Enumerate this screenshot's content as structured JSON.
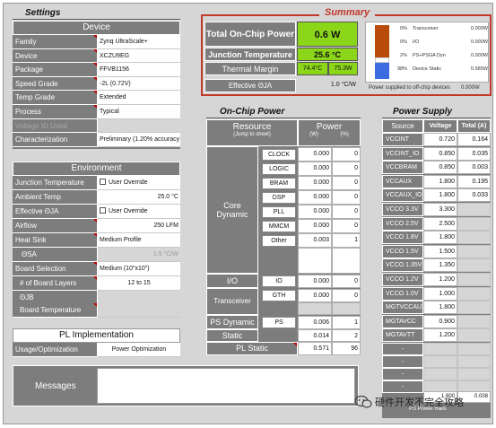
{
  "colors": {
    "accent_red": "#c0392b",
    "power_green": "#8cd61a",
    "orange": "#b84a0a",
    "blue": "#3d6be0"
  },
  "settings": {
    "title": "Settings",
    "device": {
      "header": "Device",
      "rows": [
        {
          "label": "Family",
          "value": "Zynq UltraScale+"
        },
        {
          "label": "Device",
          "value": "XCZU9EG"
        },
        {
          "label": "Package",
          "value": "FFVB1156"
        },
        {
          "label": "Speed Grade",
          "value": "-2L (0.72V)"
        },
        {
          "label": "Temp Grade",
          "value": "Extended"
        },
        {
          "label": "Process",
          "value": "Typical"
        },
        {
          "label": "Voltage ID Used",
          "value": ""
        },
        {
          "label": "Characterization",
          "value": "Preliminary (1.20% accuracy"
        }
      ]
    },
    "environment": {
      "header": "Environment",
      "junction_temp_label": "Junction Temperature",
      "junction_temp_value": "User Override",
      "ambient_label": "Ambient Temp",
      "ambient_value": "25.0 °C",
      "theta_label": "Effective ΘJA",
      "theta_value": "User Override",
      "airflow_label": "Airflow",
      "airflow_value": "250 LFM",
      "heatsink_label": "Heat Sink",
      "heatsink_value": "Medium Profile",
      "sa_label": "ΘSA",
      "sa_value": "1.5 °C/W",
      "board_sel_label": "Board Selection",
      "board_sel_value": "Medium (10\"x10\")",
      "layers_label": "# of Board Layers",
      "layers_value": "12 to 15",
      "jb_label": "ΘJB",
      "jb_value": "",
      "board_temp_label": "Board Temperature",
      "board_temp_value": ""
    },
    "pl_impl": {
      "header": "PL Implementation",
      "usage_label": "Usage/Optimization",
      "usage_value": "Power Optimization"
    }
  },
  "messages": {
    "label": "Messages",
    "text": ""
  },
  "summary": {
    "title": "Summary",
    "total_label": "Total On-Chip Power",
    "total_value": "0.6 W",
    "junction_label": "Junction Temperature",
    "junction_value": "25.6 °C",
    "margin_label": "Thermal Margin",
    "margin_c": "74.4°C",
    "margin_w": "75.3W",
    "theta_label": "Effective ΘJA",
    "theta_value": "1.0 °C/W",
    "breakdown": [
      {
        "pct": "0%",
        "name": "Transceiver",
        "value": "0.000W"
      },
      {
        "pct": "0%",
        "name": "I/O",
        "value": "0.000W"
      },
      {
        "pct": "2%",
        "name": "PS+PSGA Dyn",
        "value": "0.000W"
      },
      {
        "pct": "98%",
        "name": "Device Static",
        "value": "0.585W"
      }
    ],
    "offchip_label": "Power supplied to off-chip devices",
    "offchip_value": "0.000W"
  },
  "onchip": {
    "title": "On-Chip Power",
    "resource_header": "Resource",
    "jump_label": "(Jump to sheet)",
    "power_header": "Power",
    "w_header": "(W)",
    "pct_header": "(%)",
    "core_label": "Core Dynamic",
    "core_rows": [
      {
        "name": "CLOCK",
        "w": "0.000",
        "pct": "0"
      },
      {
        "name": "LOGIC",
        "w": "0.000",
        "pct": "0"
      },
      {
        "name": "BRAM",
        "w": "0.000",
        "pct": "0"
      },
      {
        "name": "DSP",
        "w": "0.000",
        "pct": "0"
      },
      {
        "name": "PLL",
        "w": "0.000",
        "pct": "0"
      },
      {
        "name": "MMCM",
        "w": "0.000",
        "pct": "0"
      },
      {
        "name": "Other",
        "w": "0.003",
        "pct": "1"
      }
    ],
    "io_label": "I/O",
    "io_row": {
      "name": "IO",
      "w": "0.000",
      "pct": "0"
    },
    "trans_label": "Transceiver",
    "trans_row": {
      "name": "GTH",
      "w": "0.000",
      "pct": "0"
    },
    "ps_label": "PS Dynamic",
    "ps_row": {
      "name": "PS",
      "w": "0.006",
      "pct": "1"
    },
    "static_label": "Static",
    "static_row": {
      "w": "0.014",
      "pct": "2"
    },
    "pl_static_label": "PL Static",
    "pl_static_row": {
      "w": "0.571",
      "pct": "96"
    }
  },
  "power_supply": {
    "title": "Power Supply",
    "headers": [
      "Source",
      "Voltage",
      "Total (A)"
    ],
    "rows": [
      {
        "source": "VCCINT",
        "voltage": "0.720",
        "total": "0.164"
      },
      {
        "source": "VCCINT_IO",
        "voltage": "0.850",
        "total": "0.035"
      },
      {
        "source": "VCCBRAM",
        "voltage": "0.850",
        "total": "0.003"
      },
      {
        "source": "VCCAUX",
        "voltage": "1.800",
        "total": "0.195"
      },
      {
        "source": "VCCAUX_IO",
        "voltage": "1.800",
        "total": "0.033"
      },
      {
        "source": "VCCO 3.3V",
        "voltage": "3.300",
        "total": ""
      },
      {
        "source": "VCCO 2.5V",
        "voltage": "2.500",
        "total": ""
      },
      {
        "source": "VCCO 1.8V",
        "voltage": "1.800",
        "total": ""
      },
      {
        "source": "VCCO 1.5V",
        "voltage": "1.500",
        "total": ""
      },
      {
        "source": "VCCO 1.35V",
        "voltage": "1.350",
        "total": ""
      },
      {
        "source": "VCCO 1.2V",
        "voltage": "1.200",
        "total": ""
      },
      {
        "source": "VCCO 1.0V",
        "voltage": "1.000",
        "total": ""
      },
      {
        "source": "MGTVCCAUX",
        "voltage": "1.800",
        "total": ""
      },
      {
        "source": "MGTAVCC",
        "voltage": "0.900",
        "total": ""
      },
      {
        "source": "MGTAVTT",
        "voltage": "1.200",
        "total": ""
      }
    ],
    "dash_rows": [
      "-",
      "-",
      "-",
      "-"
    ],
    "last_voltage": "1.800",
    "last_total": "0.008",
    "footer": "PS Power Rails"
  },
  "watermark": "硬件开发不完全攻略"
}
